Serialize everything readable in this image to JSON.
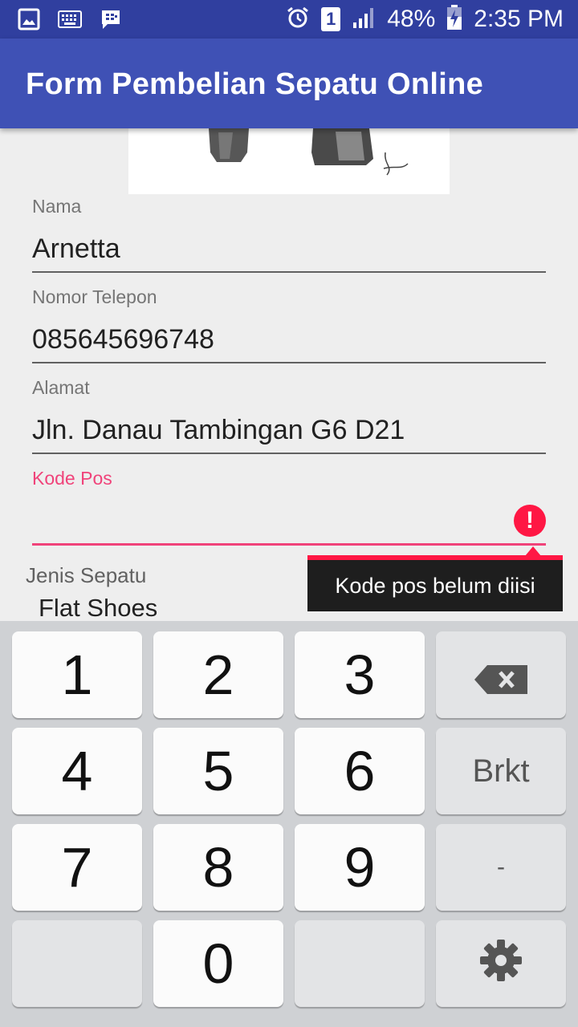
{
  "status_bar": {
    "battery": "48%",
    "time": "2:35 PM",
    "sim_slot": "1",
    "icons": [
      "image-icon",
      "keyboard-icon",
      "bbm-icon",
      "alarm-icon",
      "sim-icon",
      "signal-icon",
      "battery-charging-icon"
    ]
  },
  "app_bar": {
    "title": "Form Pembelian Sepatu Online",
    "color": "#3f51b5"
  },
  "form": {
    "nama": {
      "label": "Nama",
      "value": "Arnetta"
    },
    "telepon": {
      "label": "Nomor Telepon",
      "value": "085645696748"
    },
    "alamat": {
      "label": "Alamat",
      "value": "Jln. Danau Tambingan G6 D21"
    },
    "kode_pos": {
      "label": "Kode Pos",
      "value": "",
      "error": "Kode pos belum diisi",
      "error_color": "#f0437a"
    },
    "jenis_sepatu": {
      "label": "Jenis Sepatu",
      "value": "Flat Shoes"
    }
  },
  "keyboard": {
    "keys": [
      "1",
      "2",
      "3",
      "4",
      "5",
      "6",
      "7",
      "8",
      "9",
      "0"
    ],
    "fn_brkt": "Brkt",
    "fn_dash": "-",
    "backspace_icon": "backspace-icon",
    "settings_icon": "gear-icon"
  }
}
